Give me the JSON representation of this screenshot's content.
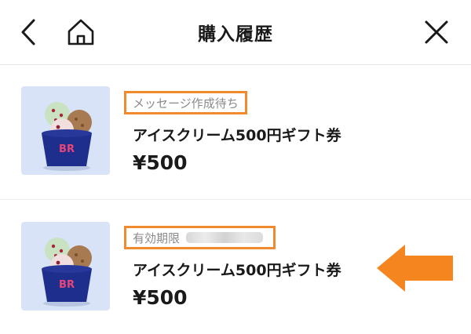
{
  "header": {
    "title": "購入履歴",
    "icons": {
      "back": "chevron-left-icon",
      "home": "home-icon",
      "close": "close-icon"
    }
  },
  "items": [
    {
      "status": "メッセージ作成待ち",
      "name": "アイスクリーム500円ギフト券",
      "price": "¥500"
    },
    {
      "status": "有効期限",
      "name": "アイスクリーム500円ギフト券",
      "price": "¥500"
    }
  ],
  "colors": {
    "highlight": "#f08a2c",
    "arrow": "#f5861f",
    "thumb_bg": "#d8e3f7",
    "cup": "#1e2e8c"
  }
}
